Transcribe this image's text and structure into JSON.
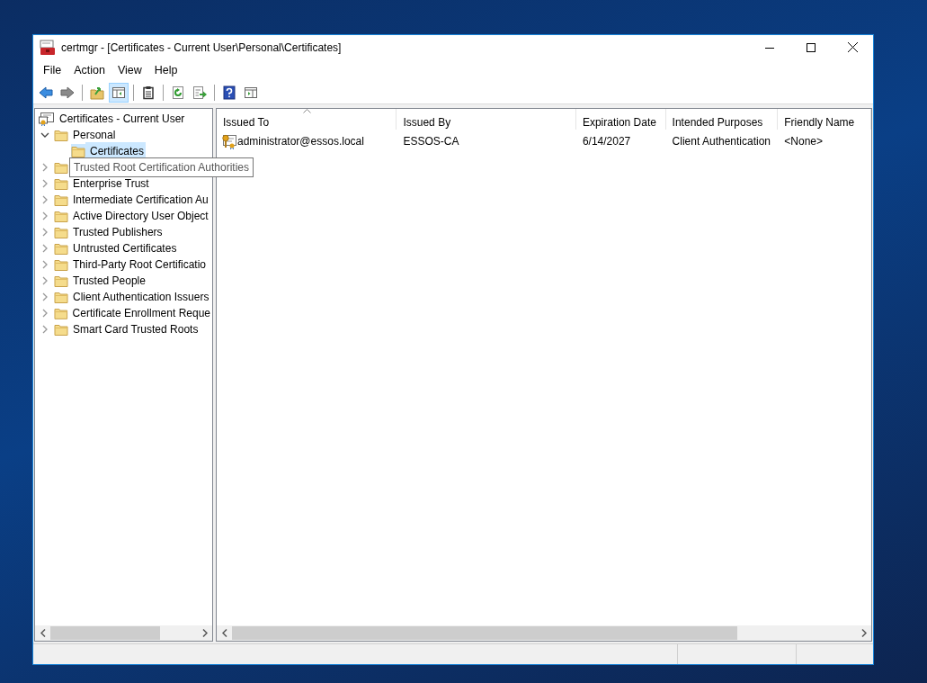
{
  "window": {
    "title": "certmgr - [Certificates - Current User\\Personal\\Certificates]"
  },
  "menu": [
    "File",
    "Action",
    "View",
    "Help"
  ],
  "toolbar": [
    {
      "kind": "back",
      "pressed": false
    },
    {
      "kind": "forward",
      "pressed": false
    },
    {
      "kind": "separator"
    },
    {
      "kind": "up",
      "pressed": false
    },
    {
      "kind": "tree",
      "pressed": true
    },
    {
      "kind": "separator"
    },
    {
      "kind": "properties",
      "pressed": false
    },
    {
      "kind": "separator"
    },
    {
      "kind": "refresh",
      "pressed": false
    },
    {
      "kind": "export",
      "pressed": false
    },
    {
      "kind": "separator"
    },
    {
      "kind": "help",
      "pressed": false
    },
    {
      "kind": "actionpane",
      "pressed": false
    }
  ],
  "tree": {
    "label": "Certificates - Current User",
    "children": [
      {
        "label": "Personal",
        "expanded": true,
        "selected": false,
        "children": [
          {
            "label": "Certificates",
            "selected": true
          }
        ]
      },
      {
        "expanded": false,
        "selected": false
      },
      {
        "label": "Enterprise Trust",
        "expanded": false,
        "selected": false
      },
      {
        "label": "Intermediate Certification Au",
        "expanded": false,
        "selected": false
      },
      {
        "label": "Active Directory User Object",
        "expanded": false,
        "selected": false
      },
      {
        "label": "Trusted Publishers",
        "expanded": false,
        "selected": false
      },
      {
        "label": "Untrusted Certificates",
        "expanded": false,
        "selected": false
      },
      {
        "label": "Third-Party Root Certificatio",
        "expanded": false,
        "selected": false
      },
      {
        "label": "Trusted People",
        "expanded": false,
        "selected": false
      },
      {
        "label": "Client Authentication Issuers",
        "expanded": false,
        "selected": false
      },
      {
        "label": "Certificate Enrollment Reque",
        "expanded": false,
        "selected": false
      },
      {
        "label": "Smart Card Trusted Roots",
        "expanded": false,
        "selected": false
      }
    ]
  },
  "tooltip": {
    "text": "Trusted Root Certification Authorities"
  },
  "table": {
    "columns": [
      {
        "label": "Issued To",
        "sorted": true
      },
      {
        "label": "Issued By",
        "sorted": false
      },
      {
        "label": "Expiration Date",
        "sorted": false
      },
      {
        "label": "Intended Purposes",
        "sorted": false
      },
      {
        "label": "Friendly Name",
        "sorted": false
      }
    ],
    "rows": [
      [
        "administrator@essos.local",
        "ESSOS-CA",
        "6/14/2027",
        "Client Authentication",
        "<None>"
      ]
    ]
  }
}
